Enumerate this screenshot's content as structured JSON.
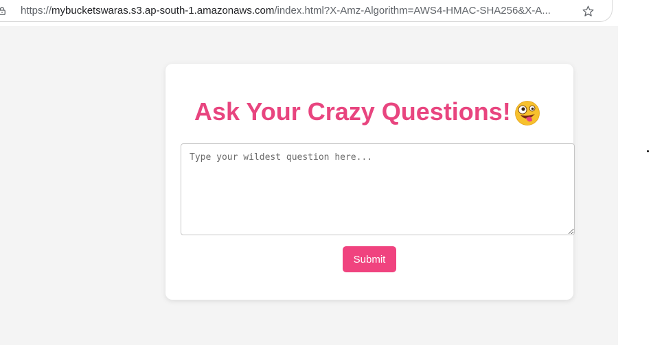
{
  "browser": {
    "url_scheme": "https://",
    "url_host": "mybucketswaras.s3.ap-south-1.amazonaws.com",
    "url_rest": "/index.html?X-Amz-Algorithm=AWS4-HMAC-SHA256&X-A...",
    "icons": {
      "lock": "lock-icon",
      "bookmark": "star-icon"
    }
  },
  "form": {
    "title": "Ask Your Crazy Questions!",
    "title_emoji": "zany-face-emoji",
    "question_placeholder": "Type your wildest question here...",
    "question_value": "",
    "submit_label": "Submit"
  },
  "colors": {
    "accent": "#e8457f",
    "button": "#f0437f",
    "page_background": "#f4f4f4",
    "card_background": "#ffffff"
  }
}
